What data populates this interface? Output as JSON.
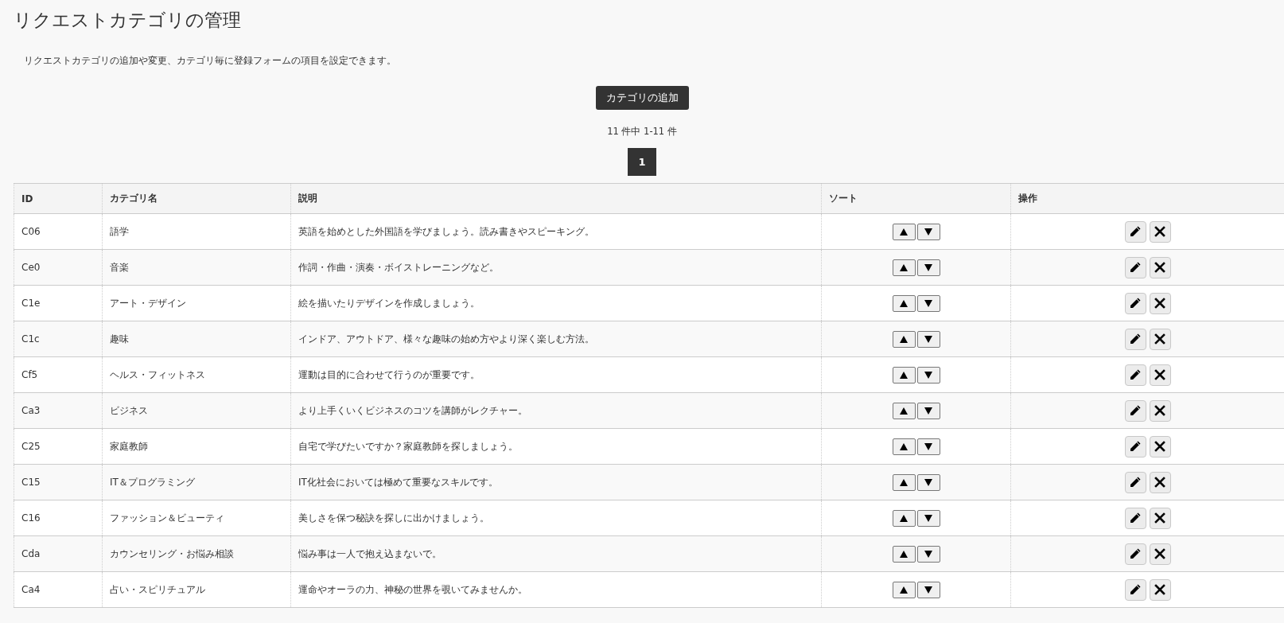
{
  "title": "リクエストカテゴリの管理",
  "description": "リクエストカテゴリの追加や変更、カテゴリ毎に登録フォームの項目を設定できます。",
  "add_button": "カテゴリの追加",
  "pagination": {
    "summary": "11 件中 1-11 件",
    "pages": [
      {
        "label": "1",
        "selected": true
      }
    ]
  },
  "table": {
    "columns": [
      "ID",
      "カテゴリ名",
      "説明",
      "ソート",
      "操作"
    ],
    "rows": [
      {
        "id": "C06",
        "name": "語学",
        "description": "英語を始めとした外国語を学びましょう。読み書きやスピーキング。"
      },
      {
        "id": "Ce0",
        "name": "音楽",
        "description": "作詞・作曲・演奏・ボイストレーニングなど。"
      },
      {
        "id": "C1e",
        "name": "アート・デザイン",
        "description": "絵を描いたりデザインを作成しましょう。"
      },
      {
        "id": "C1c",
        "name": "趣味",
        "description": "インドア、アウトドア、様々な趣味の始め方やより深く楽しむ方法。"
      },
      {
        "id": "Cf5",
        "name": "ヘルス・フィットネス",
        "description": "運動は目的に合わせて行うのが重要です。"
      },
      {
        "id": "Ca3",
        "name": "ビジネス",
        "description": "より上手くいくビジネスのコツを講師がレクチャー。"
      },
      {
        "id": "C25",
        "name": "家庭教師",
        "description": "自宅で学びたいですか？家庭教師を探しましょう。"
      },
      {
        "id": "C15",
        "name": "IT＆プログラミング",
        "description": "IT化社会においては極めて重要なスキルです。"
      },
      {
        "id": "C16",
        "name": "ファッション＆ビューティ",
        "description": "美しさを保つ秘訣を探しに出かけましょう。"
      },
      {
        "id": "Cda",
        "name": "カウンセリング・お悩み相談",
        "description": "悩み事は一人で抱え込まないで。"
      },
      {
        "id": "Ca4",
        "name": "占い・スピリチュアル",
        "description": "運命やオーラの力、神秘の世界を覗いてみませんか。"
      }
    ]
  }
}
